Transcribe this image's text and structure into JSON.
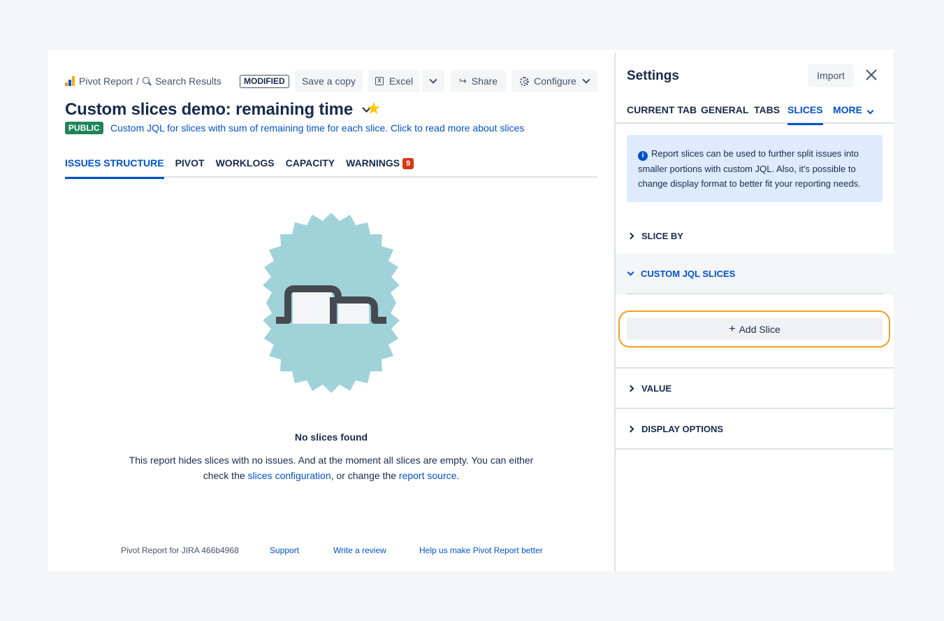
{
  "header": {
    "breadcrumb_app": "Pivot Report",
    "breadcrumb_sep": "/",
    "breadcrumb_search": "Search Results",
    "status_badge": "MODIFIED",
    "save_copy_label": "Save a copy",
    "excel_label": "Excel",
    "share_label": "Share",
    "configure_label": "Configure",
    "report_title": "Custom slices demo: remaining time",
    "visibility_badge": "PUBLIC",
    "description": "Custom JQL for slices with sum of remaining time for each slice. Click to read more about slices"
  },
  "tabs": [
    {
      "label": "ISSUES STRUCTURE",
      "active": true
    },
    {
      "label": "PIVOT"
    },
    {
      "label": "WORKLOGS"
    },
    {
      "label": "CAPACITY"
    },
    {
      "label": "WARNINGS",
      "badge": "9"
    }
  ],
  "empty_state": {
    "title": "No slices found",
    "line1": "This report hides slices with no issues. And at the moment all slices are empty. You can either",
    "line2_prefix": "check the ",
    "link1": "slices configuration",
    "line2_middle": ", or change the ",
    "link2": "report source",
    "line2_suffix": "."
  },
  "footer": {
    "version": "Pivot Report for JIRA 466b4968",
    "support": "Support",
    "review": "Write a review",
    "feedback": "Help us make Pivot Report better"
  },
  "settings": {
    "title": "Settings",
    "import_label": "Import",
    "tabs": [
      "CURRENT TAB",
      "GENERAL",
      "TABS",
      "SLICES",
      "MORE"
    ],
    "active_tab": "SLICES",
    "info_text": "Report slices can be used to further split issues into smaller portions with custom JQL. Also, it's possible to change display format to better fit your reporting needs.",
    "sections": {
      "slice_by": "SLICE BY",
      "custom_jql": "CUSTOM JQL SLICES",
      "value": "VALUE",
      "display_options": "DISPLAY OPTIONS"
    },
    "add_slice_label": "Add Slice"
  },
  "colors": {
    "accent": "#0052cc",
    "public_badge": "#1f845a",
    "warning_badge": "#de350b",
    "highlight_ring": "#f2a122",
    "illustration_teal": "#a0d2da"
  },
  "icons": {
    "breadcrumb_logo": "pivot-report-logo-icon",
    "breadcrumb_search": "search-icon",
    "excel": "excel-icon",
    "share": "share-icon",
    "configure": "gear-icon",
    "star": "star-icon",
    "close": "close-icon",
    "info": "info-icon"
  }
}
